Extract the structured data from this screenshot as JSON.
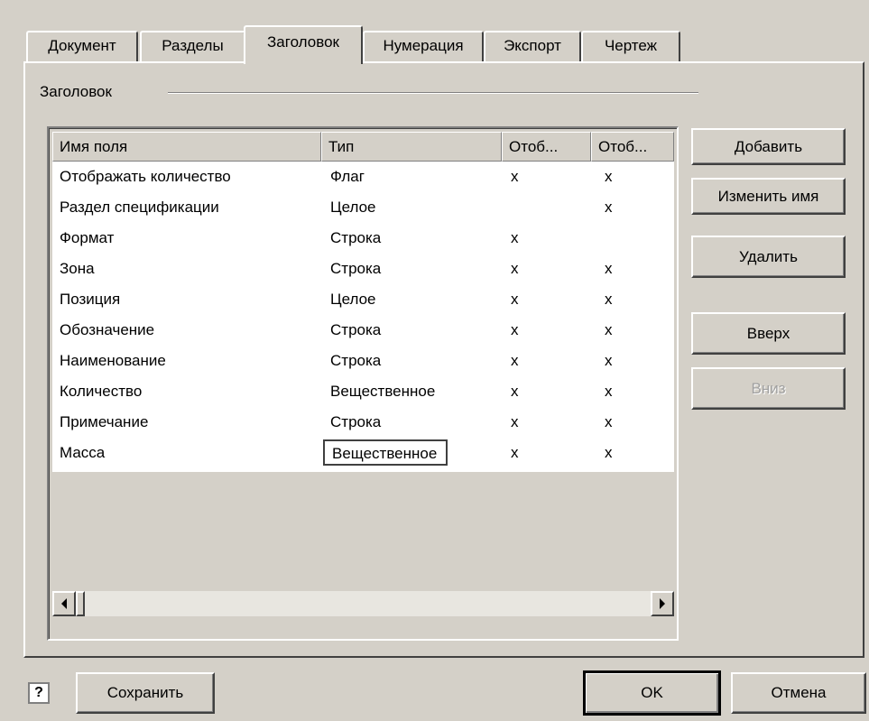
{
  "tabs": [
    "Документ",
    "Разделы",
    "Заголовок",
    "Нумерация",
    "Экспорт",
    "Чертеж"
  ],
  "active_tab": "Заголовок",
  "group": {
    "title": "Заголовок"
  },
  "table": {
    "columns": [
      "Имя поля",
      "Тип",
      "Отоб...",
      "Отоб..."
    ],
    "rows": [
      [
        "Отображать количество",
        "Флаг",
        "x",
        "x"
      ],
      [
        "Раздел спецификации",
        "Целое",
        "",
        "x"
      ],
      [
        "Формат",
        "Строка",
        "x",
        ""
      ],
      [
        "Зона",
        "Строка",
        "x",
        "x"
      ],
      [
        "Позиция",
        "Целое",
        "x",
        "x"
      ],
      [
        "Обозначение",
        "Строка",
        "x",
        "x"
      ],
      [
        "Наименование",
        "Строка",
        "x",
        "x"
      ],
      [
        "Количество",
        "Вещественное",
        "x",
        "x"
      ],
      [
        "Примечание",
        "Строка",
        "x",
        "x"
      ],
      [
        "Масса",
        "Вещественное",
        "x",
        "x"
      ]
    ],
    "focused_cell": {
      "row": 9,
      "column": 1
    }
  },
  "side_buttons": {
    "add": "Добавить",
    "rename": "Изменить имя",
    "delete": "Удалить",
    "up": "Вверх",
    "down": "Вниз"
  },
  "bottom": {
    "help_icon_glyph": "?",
    "save": "Сохранить",
    "ok": "OK",
    "cancel": "Отмена"
  },
  "icons": [
    "help-icon",
    "scroll-left-arrow-icon",
    "scroll-right-arrow-icon"
  ]
}
